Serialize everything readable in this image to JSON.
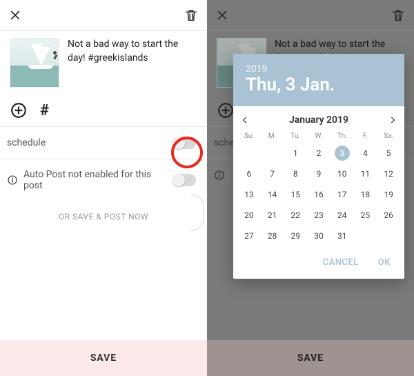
{
  "post": {
    "caption": "Not a bad way to start the day! #greekislands"
  },
  "rows": {
    "schedule_label": "schedule",
    "autopost_label": "Auto Post not enabled for this post",
    "or_label": "OR SAVE & POST NOW"
  },
  "buttons": {
    "save": "SAVE",
    "save_right": "SAVE",
    "cancel": "CANCEL",
    "ok": "OK"
  },
  "calendar": {
    "year": "2019",
    "header_date": "Thu, 3 Jan.",
    "month_label": "January 2019",
    "dow": [
      "Su.",
      "M.",
      "Tu.",
      "W.",
      "Th.",
      "F.",
      "Sa."
    ],
    "lead_blanks": 2,
    "days": 31,
    "selected": 3
  }
}
